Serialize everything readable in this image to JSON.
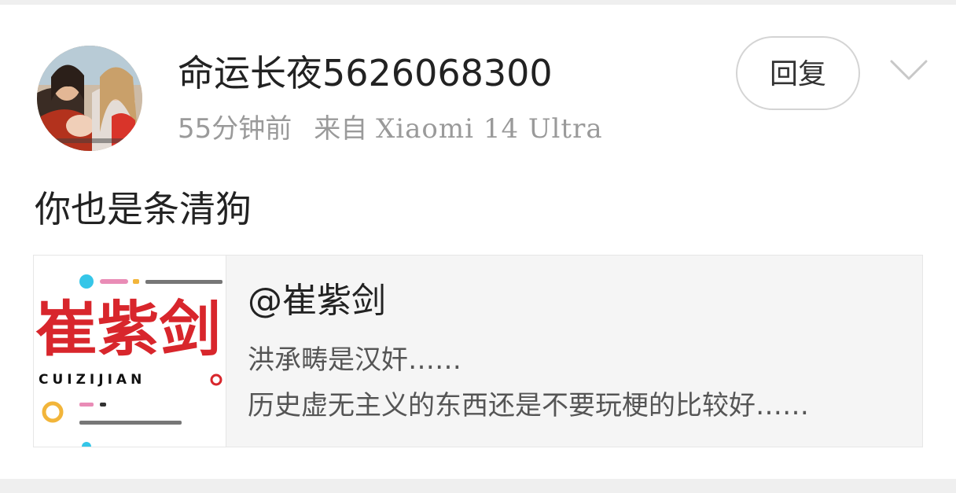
{
  "comment": {
    "username": "命运长夜5626068300",
    "time": "55分钟前",
    "source": "来自",
    "device": "Xiaomi 14 Ultra",
    "content": "你也是条清狗"
  },
  "actions": {
    "reply_label": "回复",
    "more_icon": "chevron-down-icon"
  },
  "shared_card": {
    "logo_text": "崔紫剑",
    "logo_subtext": "CUIZIJIAN",
    "title": "@崔紫剑",
    "lines": [
      "洪承畴是汉奸……",
      "历史虚无主义的东西还是不要玩梗的比较好……"
    ]
  },
  "colors": {
    "logo_red": "#d8262c",
    "accent_cyan": "#35c6e8",
    "accent_pink": "#e98cb6",
    "accent_orange": "#f2b53a"
  }
}
